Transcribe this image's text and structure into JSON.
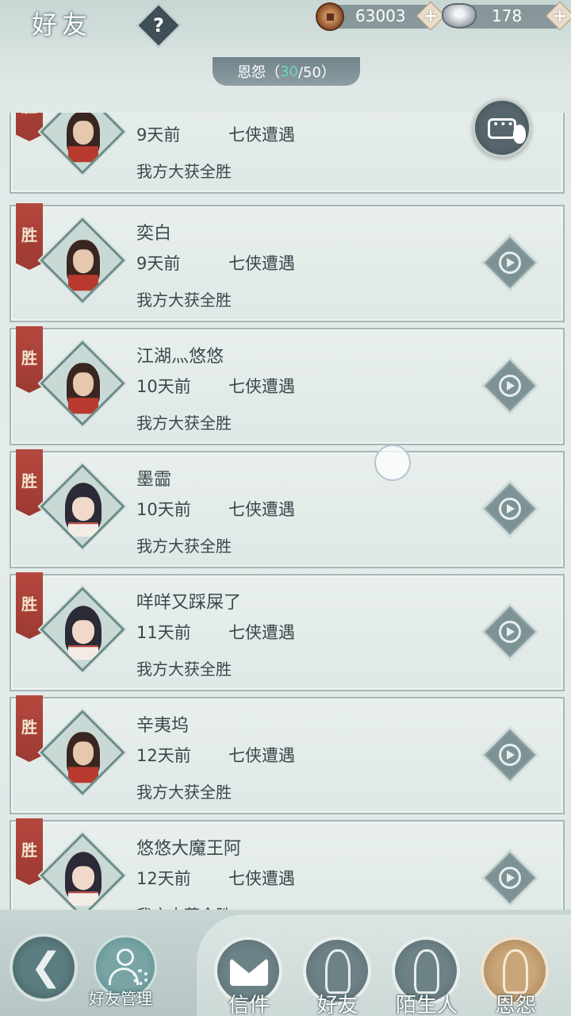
{
  "header": {
    "title": "好友",
    "help_label": "?",
    "coins": "63003",
    "silver": "178",
    "plus_label": "+",
    "tab_enmity": {
      "label": "恩怨",
      "open": "（",
      "count": "30",
      "sep": "/50）"
    }
  },
  "records": [
    {
      "result_tag": "胜",
      "name": "",
      "time": "9天前",
      "mode": "七侠遭遇",
      "result": "我方大获全胜",
      "avatar": "male"
    },
    {
      "result_tag": "胜",
      "name": "奕白",
      "time": "9天前",
      "mode": "七侠遭遇",
      "result": "我方大获全胜",
      "avatar": "male"
    },
    {
      "result_tag": "胜",
      "name": "江湖灬悠悠",
      "time": "10天前",
      "mode": "七侠遭遇",
      "result": "我方大获全胜",
      "avatar": "male"
    },
    {
      "result_tag": "胜",
      "name": "墨霝",
      "time": "10天前",
      "mode": "七侠遭遇",
      "result": "我方大获全胜",
      "avatar": "female"
    },
    {
      "result_tag": "胜",
      "name": "咩咩又踩屎了",
      "time": "11天前",
      "mode": "七侠遭遇",
      "result": "我方大获全胜",
      "avatar": "female"
    },
    {
      "result_tag": "胜",
      "name": "辛夷坞",
      "time": "12天前",
      "mode": "七侠遭遇",
      "result": "我方大获全胜",
      "avatar": "male"
    },
    {
      "result_tag": "胜",
      "name": "悠悠大魔王阿",
      "time": "12天前",
      "mode": "七侠遭遇",
      "result": "我方大获全胜",
      "avatar": "female"
    }
  ],
  "bottom": {
    "friend_manage": "好友管理",
    "tabs": [
      {
        "label": "信件",
        "icon": "envelope-icon"
      },
      {
        "label": "好友",
        "icon": "friend-icon"
      },
      {
        "label": "陌生人",
        "icon": "stranger-icon"
      },
      {
        "label": "恩怨",
        "icon": "enmity-icon"
      }
    ],
    "active_tab": "恩怨"
  },
  "colors": {
    "ribbon": "#b4483e",
    "accent_count": "#6fd6c0",
    "active_tab": "#c9a67a"
  }
}
